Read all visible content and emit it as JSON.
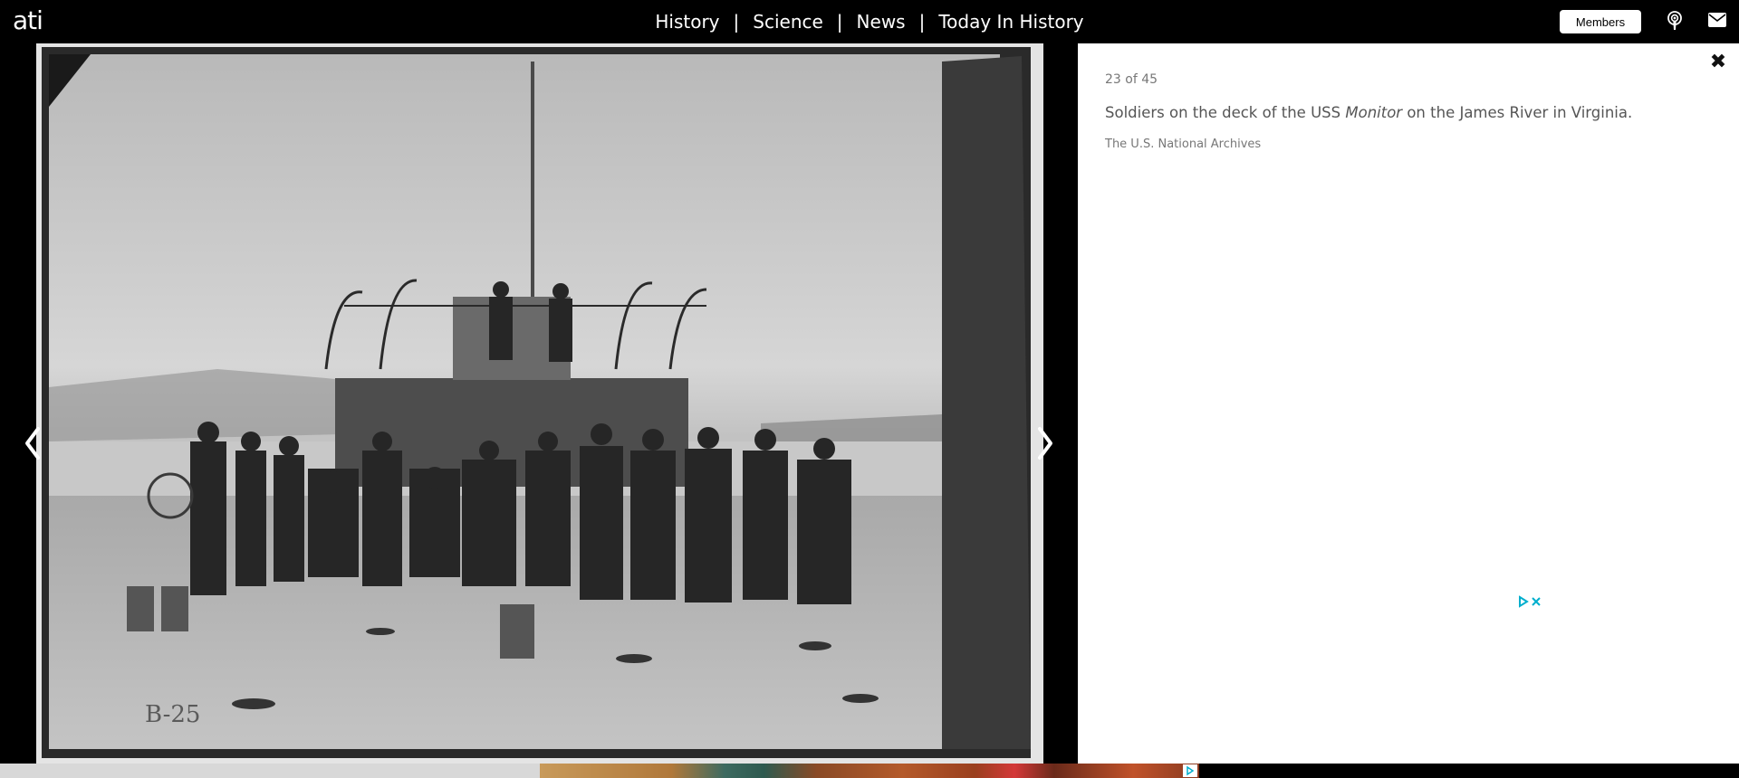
{
  "site": {
    "logo": "ati"
  },
  "nav": {
    "items": [
      "History",
      "Science",
      "News",
      "Today In History"
    ],
    "separator": "|"
  },
  "header": {
    "members_label": "Members"
  },
  "icons": {
    "podcast": "podcast-icon",
    "mail": "mail-icon",
    "close": "close-icon",
    "prev": "chevron-left-icon",
    "next": "chevron-right-icon",
    "adchoices": "adchoices-icon"
  },
  "gallery": {
    "counter": "23 of 45",
    "caption_before": "Soldiers on the deck of the USS ",
    "caption_italic": "Monitor",
    "caption_after": " on the James River in Virginia.",
    "credit": "The U.S. National Archives",
    "close_symbol": "✖"
  },
  "photo": {
    "plate_marking": "B-25"
  },
  "colors": {
    "topbar_bg": "#000000",
    "panel_bg": "#ffffff",
    "caption_text": "#555555",
    "adchoices_blue": "#00aecd"
  }
}
